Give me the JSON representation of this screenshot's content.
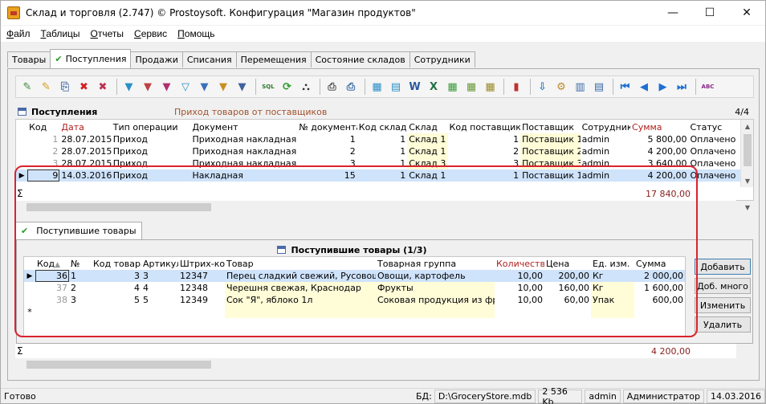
{
  "window": {
    "title": "Склад и торговля (2.747) © Prostoysoft. Конфигурация \"Магазин продуктов\"",
    "minimize": "—",
    "maximize": "☐",
    "close": "✕"
  },
  "menu": [
    {
      "underline": "Ф",
      "rest": "айл"
    },
    {
      "underline": "Т",
      "rest": "аблицы"
    },
    {
      "underline": "О",
      "rest": "тчеты"
    },
    {
      "underline": "С",
      "rest": "ервис"
    },
    {
      "underline": "П",
      "rest": "омощь"
    }
  ],
  "tabs": [
    "Товары",
    "Поступления",
    "Продажи",
    "Списания",
    "Перемещения",
    "Состояние складов",
    "Сотрудники"
  ],
  "active_tab_check": "✔",
  "toolbar_icons": [
    {
      "name": "add-record-icon",
      "glyph": "✎",
      "color": "#3b8a3b"
    },
    {
      "name": "edit-record-icon",
      "glyph": "✎",
      "color": "#d89c1a"
    },
    {
      "name": "copy-record-icon",
      "glyph": "⎘",
      "color": "#5577aa"
    },
    {
      "name": "delete-record-icon",
      "glyph": "✖",
      "color": "#d02020"
    },
    {
      "name": "delete-all-icon",
      "glyph": "✖",
      "color": "#c03050"
    },
    {
      "name": "filter-icon",
      "glyph": "▼",
      "color": "#2a8fc8"
    },
    {
      "name": "filter-clear-icon",
      "glyph": "▼",
      "color": "#c04040"
    },
    {
      "name": "filter-remove-icon",
      "glyph": "▼",
      "color": "#b03070"
    },
    {
      "name": "filter-edit-icon",
      "glyph": "▽",
      "color": "#2a8fc8"
    },
    {
      "name": "filter-apply-icon",
      "glyph": "▼",
      "color": "#3a70b8"
    },
    {
      "name": "find-icon",
      "glyph": "▼",
      "color": "#c89020"
    },
    {
      "name": "find-next-icon",
      "glyph": "▼",
      "color": "#4060a0"
    },
    {
      "name": "sql-icon",
      "glyph": "SQL",
      "color": "#2a7a2a"
    },
    {
      "name": "refresh-icon",
      "glyph": "⟳",
      "color": "#2a9a2a"
    },
    {
      "name": "binoculars-icon",
      "glyph": "⛬",
      "color": "#333333"
    },
    {
      "name": "print-icon",
      "glyph": "⎙",
      "color": "#555555"
    },
    {
      "name": "print-preview-icon",
      "glyph": "⎙",
      "color": "#3a6aa8"
    },
    {
      "name": "export-icon",
      "glyph": "▦",
      "color": "#2a8fc8"
    },
    {
      "name": "export-doc-icon",
      "glyph": "▤",
      "color": "#2a8fc8"
    },
    {
      "name": "word-icon",
      "glyph": "W",
      "color": "#2b579a"
    },
    {
      "name": "excel-icon",
      "glyph": "X",
      "color": "#217346"
    },
    {
      "name": "export-csv-icon",
      "glyph": "▦",
      "color": "#3a9a3a"
    },
    {
      "name": "export-txt-icon",
      "glyph": "▦",
      "color": "#6a9a3a"
    },
    {
      "name": "export-xml-icon",
      "glyph": "▦",
      "color": "#9a8a2a"
    },
    {
      "name": "chart-icon",
      "glyph": "▮",
      "color": "#c03030"
    },
    {
      "name": "import-icon",
      "glyph": "⇩",
      "color": "#2a7fc8"
    },
    {
      "name": "settings-icon",
      "glyph": "⚙",
      "color": "#c08a20"
    },
    {
      "name": "columns-icon",
      "glyph": "▥",
      "color": "#3a6aa8"
    },
    {
      "name": "layout-icon",
      "glyph": "▤",
      "color": "#3a6aa8"
    },
    {
      "name": "first-record-icon",
      "glyph": "⏮",
      "color": "#1e6fd0"
    },
    {
      "name": "prev-record-icon",
      "glyph": "◀",
      "color": "#1e6fd0"
    },
    {
      "name": "next-record-icon",
      "glyph": "▶",
      "color": "#1e6fd0"
    },
    {
      "name": "last-record-icon",
      "glyph": "⏭",
      "color": "#1e6fd0"
    },
    {
      "name": "spellcheck-icon",
      "glyph": "ABC",
      "color": "#8a2a8a"
    }
  ],
  "receipts": {
    "title": "Поступления",
    "subtitle": "Приход товаров от поставщиков",
    "count": "4/4",
    "columns": [
      "Код",
      "Дата",
      "Тип операции",
      "Документ",
      "№ документа",
      "Код склада",
      "Склад",
      "Код поставщика",
      "Поставщик",
      "Сотрудник",
      "Сумма",
      "Статус"
    ],
    "rows": [
      {
        "code": "1",
        "date": "28.07.2015",
        "type": "Приход",
        "doc": "Приходная накладная",
        "num": "1",
        "wh_code": "1",
        "wh": "Склад 1",
        "sup_code": "1",
        "sup": "Поставщик 1",
        "emp": "admin",
        "sum": "5 800,00",
        "status": "Оплачено"
      },
      {
        "code": "2",
        "date": "28.07.2015",
        "type": "Приход",
        "doc": "Приходная накладная",
        "num": "2",
        "wh_code": "1",
        "wh": "Склад 1",
        "sup_code": "2",
        "sup": "Поставщик 2",
        "emp": "admin",
        "sum": "4 200,00",
        "status": "Оплачено"
      },
      {
        "code": "3",
        "date": "28.07.2015",
        "type": "Приход",
        "doc": "Приходная накладная",
        "num": "3",
        "wh_code": "1",
        "wh": "Склад 3",
        "sup_code": "3",
        "sup": "Поставщик 3",
        "emp": "admin",
        "sum": "3 640,00",
        "status": "Оплачено"
      },
      {
        "code": "9",
        "date": "14.03.2016",
        "type": "Приход",
        "doc": "Накладная",
        "num": "15",
        "wh_code": "1",
        "wh": "Склад 1",
        "sup_code": "1",
        "sup": "Поставщик 1",
        "emp": "admin",
        "sum": "4 200,00",
        "status": "Оплачено"
      }
    ],
    "total": "17 840,00"
  },
  "items_tab": "Поступившие товары",
  "items": {
    "title": "Поступившие товары (1/3)",
    "columns": [
      "Код",
      "№",
      "Код товара",
      "Артикул",
      "Штрих-код",
      "Товар",
      "Товарная группа",
      "Количество",
      "Цена",
      "Ед. изм.",
      "Сумма"
    ],
    "rows": [
      {
        "code": "36",
        "n": "1",
        "pcode": "3",
        "art": "3",
        "barcode": "12347",
        "product": "Перец  сладкий  свежий, Русовощи",
        "group": "Овощи, картофель",
        "qty": "10,00",
        "price": "200,00",
        "unit": "Кг",
        "sum": "2 000,00"
      },
      {
        "code": "37",
        "n": "2",
        "pcode": "4",
        "art": "4",
        "barcode": "12348",
        "product": "Черешня  свежая, Краснодар",
        "group": "Фрукты",
        "qty": "10,00",
        "price": "160,00",
        "unit": "Кг",
        "sum": "1 600,00"
      },
      {
        "code": "38",
        "n": "3",
        "pcode": "5",
        "art": "5",
        "barcode": "12349",
        "product": "Сок  \"Я\", яблоко 1л",
        "group": "Соковая  продукция  из фру",
        "qty": "10,00",
        "price": "60,00",
        "unit": "Упак",
        "sum": "600,00"
      }
    ],
    "total": "4 200,00",
    "new_row_marker": "*"
  },
  "buttons": {
    "add": "Добавить",
    "add_many": "Доб. много",
    "edit": "Изменить",
    "delete": "Удалить"
  },
  "sigma": "Σ",
  "status": {
    "ready": "Готово",
    "db_label": "БД:",
    "db_path": "D:\\GroceryStore.mdb",
    "db_size": "2 536 Kb",
    "user": "admin",
    "role": "Администратор",
    "date": "14.03.2016"
  },
  "colors": {
    "highlight_border": "#d9232e",
    "selected_row": "#cfe3fb",
    "lookup_cell": "#fffcd8",
    "total_text": "#8b2020"
  }
}
